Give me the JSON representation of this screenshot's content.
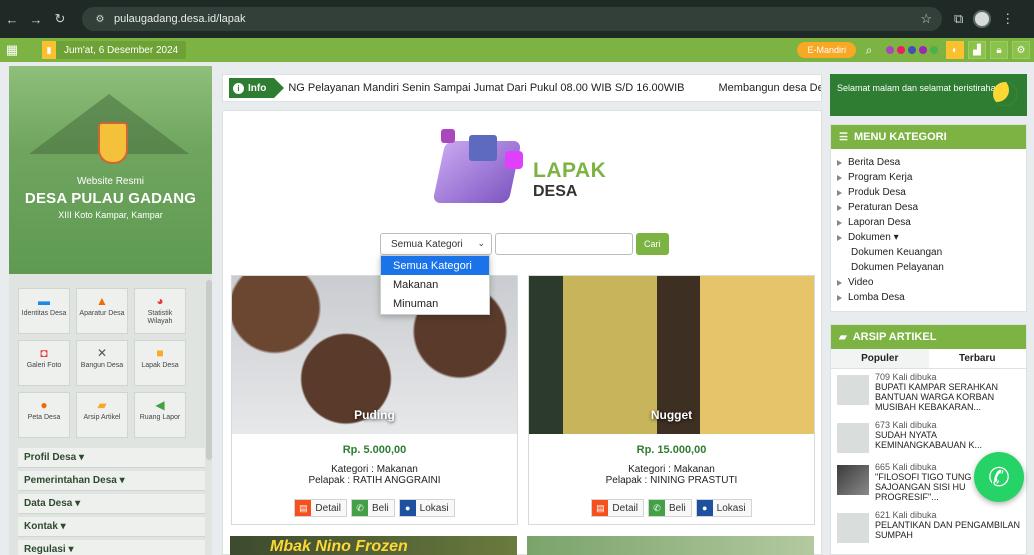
{
  "browser": {
    "url": "pulaugadang.desa.id/lapak"
  },
  "topbar": {
    "date": "Jum'at, 6 Desember 2024",
    "emandiri_label": "E-Mandiri",
    "theme_dot_colors": [
      "#ab47bc",
      "#e91e63",
      "#3f51b5",
      "#9c27b0",
      "#4caf50"
    ]
  },
  "banner": {
    "subtitle": "Website Resmi",
    "title": "DESA PULAU GADANG",
    "location": "XIII Koto Kampar, Kampar"
  },
  "tiles": [
    {
      "label": "Identitas Desa",
      "icon": "chat-icon",
      "color": "#1e88e5"
    },
    {
      "label": "Aparatur Desa",
      "icon": "user-icon",
      "color": "#ef6c00"
    },
    {
      "label": "Statistik Wilayah",
      "icon": "pie-chart-icon",
      "color": "#e53935"
    },
    {
      "label": "Galeri Foto",
      "icon": "camera-icon",
      "color": "#e53935"
    },
    {
      "label": "Bangun Desa",
      "icon": "tools-icon",
      "color": "#555555"
    },
    {
      "label": "Lapak Desa",
      "icon": "shop-icon",
      "color": "#f9a825"
    },
    {
      "label": "Peta Desa",
      "icon": "map-pin-icon",
      "color": "#ef6c00"
    },
    {
      "label": "Arsip Artikel",
      "icon": "folder-icon",
      "color": "#f9a825"
    },
    {
      "label": "Ruang Lapor",
      "icon": "megaphone-icon",
      "color": "#43a047"
    }
  ],
  "left_menu": [
    "Profil Desa ▾",
    "Pemerintahan Desa ▾",
    "Data Desa ▾",
    "Kontak ▾",
    "Regulasi ▾"
  ],
  "info": {
    "badge": "Info",
    "marquee_1": "NG Pelayanan Mandiri Senin Sampai Jumat Dari Pukul 08.00 WIB S/D 16.00WIB",
    "marquee_2": "Membangun desa Deng"
  },
  "lapak": {
    "logo_line1": "LAPAK",
    "logo_line2": "DESA",
    "select_value": "Semua Kategori",
    "search_placeholder": "",
    "search_button": "Cari",
    "options": [
      "Semua Kategori",
      "Makanan",
      "Minuman"
    ]
  },
  "products": [
    {
      "name": "Puding",
      "price": "Rp. 5.000,00",
      "kategori": "Kategori : Makanan",
      "pelapak": "Pelapak : RATIH ANGGRAINI"
    },
    {
      "name": "Nugget",
      "price": "Rp. 15.000,00",
      "kategori": "Kategori : Makanan",
      "pelapak": "Pelapak : NINING PRASTUTI"
    }
  ],
  "product_buttons": {
    "detail": "Detail",
    "beli": "Beli",
    "lokasi": "Lokasi"
  },
  "peek": {
    "banner_text": "Mbak Nino Frozen"
  },
  "right": {
    "greeting": "Selamat malam dan selamat beristirahat",
    "menu_title": "MENU KATEGORI",
    "categories": [
      "Berita Desa",
      "Program Kerja",
      "Produk Desa",
      "Peraturan Desa",
      "Laporan Desa",
      "Dokumen ▾",
      "Dokumen Keuangan",
      "Dokumen Pelayanan",
      "Video",
      "Lomba Desa"
    ],
    "arsip_title": "ARSIP ARTIKEL",
    "tab_popular": "Populer",
    "tab_latest": "Terbaru",
    "articles": [
      {
        "views": "709 Kali dibuka",
        "title": "BUPATI KAMPAR SERAHKAN BANTUAN WARGA KORBAN MUSIBAH KEBAKARAN..."
      },
      {
        "views": "673 Kali dibuka",
        "title": "SUDAH NYATA KEMINANGKABAUAN K..."
      },
      {
        "views": "665 Kali dibuka",
        "title": "\"FILOSOFI TIGO TUNG SAJOANGAN SISI HU PROGRESIF\"..."
      },
      {
        "views": "621 Kali dibuka",
        "title": "PELANTIKAN DAN PENGAMBILAN SUMPAH"
      }
    ]
  }
}
